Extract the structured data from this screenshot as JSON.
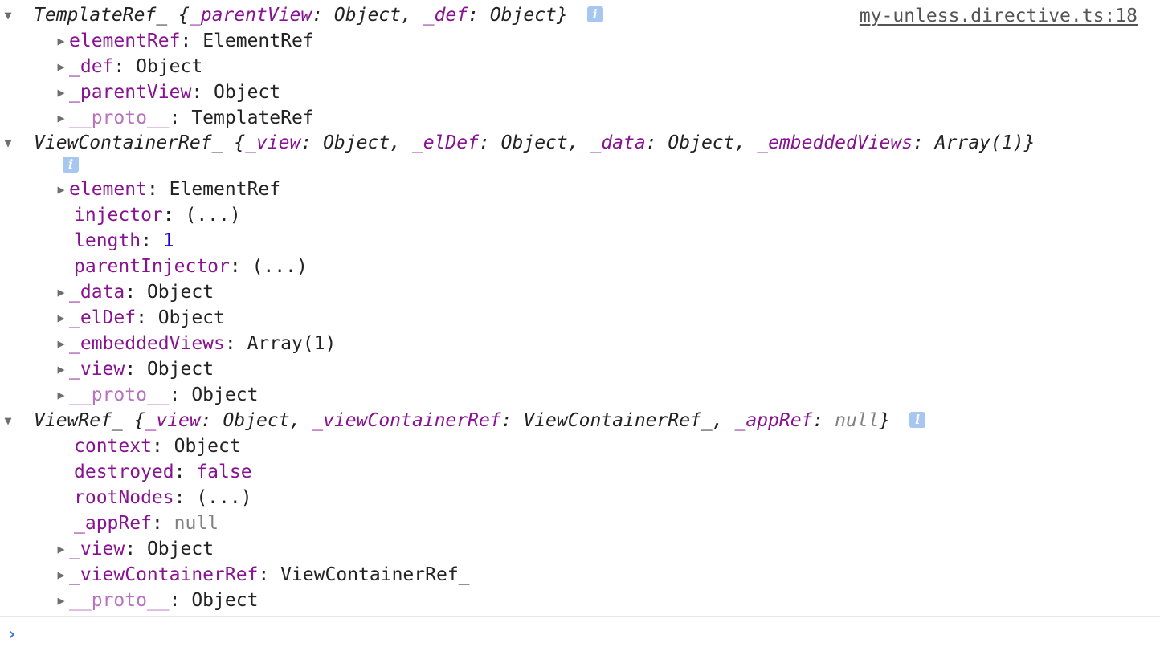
{
  "source_link": "my-unless.directive.ts:18",
  "templateRef": {
    "summary": {
      "name": "TemplateRef_",
      "open": "{",
      "props": [
        {
          "key": "_parentView",
          "value": "Object"
        },
        {
          "key": "_def",
          "value": "Object"
        }
      ],
      "sep": ": ",
      "comma": ", ",
      "close": "}"
    },
    "info_icon": "i",
    "props": [
      {
        "key": "elementRef",
        "value": "ElementRef"
      },
      {
        "key": "_def",
        "value": "Object"
      },
      {
        "key": "_parentView",
        "value": "Object"
      },
      {
        "key": "__proto__",
        "value": "TemplateRef"
      }
    ]
  },
  "viewContainerRef": {
    "summary": {
      "name": "ViewContainerRef_",
      "open": "{",
      "props": [
        {
          "key": "_view",
          "value": "Object"
        },
        {
          "key": "_elDef",
          "value": "Object"
        },
        {
          "key": "_data",
          "value": "Object"
        },
        {
          "key": "_embeddedViews",
          "value": "Array(1)"
        }
      ],
      "close": "}"
    },
    "info_icon": "i",
    "props": [
      {
        "key": "element",
        "value": "ElementRef"
      },
      {
        "key": "injector",
        "value": "(...)"
      },
      {
        "key": "length",
        "value": "1"
      },
      {
        "key": "parentInjector",
        "value": "(...)"
      },
      {
        "key": "_data",
        "value": "Object"
      },
      {
        "key": "_elDef",
        "value": "Object"
      },
      {
        "key": "_embeddedViews",
        "value": "Array(1)"
      },
      {
        "key": "_view",
        "value": "Object"
      },
      {
        "key": "__proto__",
        "value": "Object"
      }
    ]
  },
  "viewRef": {
    "summary": {
      "name": "ViewRef_",
      "open": "{",
      "props": [
        {
          "key": "_view",
          "value": "Object"
        },
        {
          "key": "_viewContainerRef",
          "value": "ViewContainerRef_"
        },
        {
          "key": "_appRef",
          "value": "null"
        }
      ],
      "close": "}"
    },
    "info_icon": "i",
    "props": [
      {
        "key": "context",
        "value": "Object"
      },
      {
        "key": "destroyed",
        "value": "false"
      },
      {
        "key": "rootNodes",
        "value": "(...)"
      },
      {
        "key": "_appRef",
        "value": "null"
      },
      {
        "key": "_view",
        "value": "Object"
      },
      {
        "key": "_viewContainerRef",
        "value": "ViewContainerRef_"
      },
      {
        "key": "__proto__",
        "value": "Object"
      }
    ]
  },
  "glyphs": {
    "expanded": "▼",
    "collapsed": "▶",
    "prompt": "›"
  },
  "colors": {
    "key": "#881391",
    "proto_key": "#b872c0",
    "number": "#1c00cf",
    "null": "#808080",
    "prompt": "#3879d9",
    "info_bg": "#a8c7f0"
  }
}
